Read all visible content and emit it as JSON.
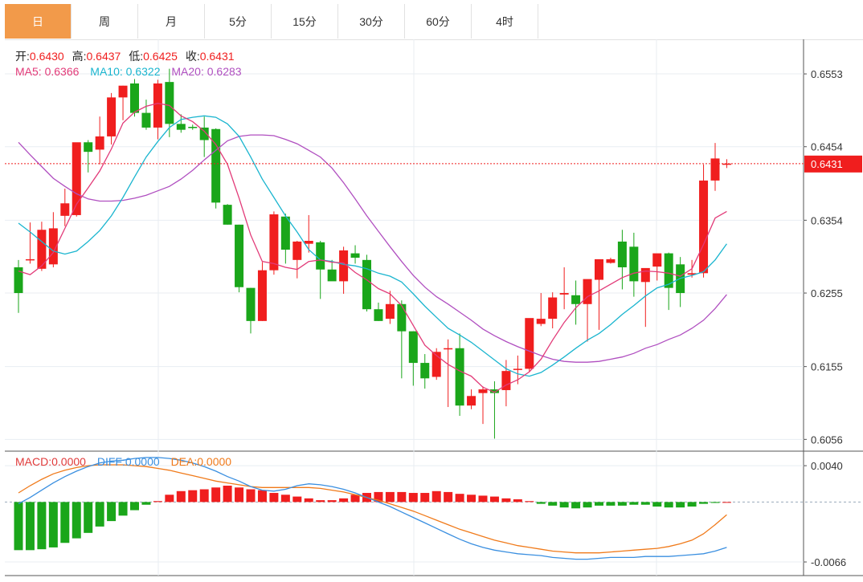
{
  "tabs": [
    "日",
    "周",
    "月",
    "5分",
    "15分",
    "30分",
    "60分",
    "4时"
  ],
  "active_tab": 0,
  "ohlc_info": [
    {
      "label": "开:",
      "value": "0.6430"
    },
    {
      "label": "高:",
      "value": "0.6437"
    },
    {
      "label": "低:",
      "value": "0.6425"
    },
    {
      "label": "收:",
      "value": "0.6431"
    }
  ],
  "ma_info": [
    {
      "label": "MA5:",
      "value": "0.6366",
      "color": "#e23a78"
    },
    {
      "label": "MA10:",
      "value": "0.6322",
      "color": "#1ab5cf"
    },
    {
      "label": "MA20:",
      "value": "0.6283",
      "color": "#b04fc0"
    }
  ],
  "macd_info": [
    {
      "label": "MACD:",
      "value": "0.0000",
      "color": "#e03a3a"
    },
    {
      "label": "DIFF:",
      "value": "0.0000",
      "color": "#3a8fe0"
    },
    {
      "label": "DEA:",
      "value": "0.0000",
      "color": "#f07a1a"
    }
  ],
  "last_price_label": "0.6431",
  "colors": {
    "up": "#f01e1e",
    "down": "#1aa61a",
    "ma5": "#e23a78",
    "ma10": "#1ab5cf",
    "ma20": "#b04fc0",
    "diff": "#3a8fe0",
    "dea": "#f07a1a",
    "price_tag": "#f01e1e"
  },
  "chart_data": {
    "type": "candlestick",
    "y_ticks": [
      "0.6553",
      "0.6454",
      "0.6354",
      "0.6255",
      "0.6155",
      "0.6056"
    ],
    "ylim": [
      0.604,
      0.66
    ],
    "last_price": 0.6431,
    "candles": [
      [
        0.629,
        0.63,
        0.6228,
        0.6255
      ],
      [
        0.6301,
        0.6351,
        0.6295,
        0.6301
      ],
      [
        0.6288,
        0.6352,
        0.6285,
        0.6341
      ],
      [
        0.6294,
        0.6365,
        0.629,
        0.6343
      ],
      [
        0.636,
        0.6397,
        0.6346,
        0.6377
      ],
      [
        0.6361,
        0.6445,
        0.6359,
        0.646
      ],
      [
        0.646,
        0.6463,
        0.6419,
        0.6447
      ],
      [
        0.645,
        0.6495,
        0.643,
        0.6468
      ],
      [
        0.6468,
        0.6527,
        0.6457,
        0.6521
      ],
      [
        0.6521,
        0.6537,
        0.649,
        0.6537
      ],
      [
        0.654,
        0.6546,
        0.6495,
        0.65
      ],
      [
        0.65,
        0.6518,
        0.6477,
        0.648
      ],
      [
        0.648,
        0.6545,
        0.6464,
        0.654
      ],
      [
        0.6542,
        0.656,
        0.6467,
        0.6485
      ],
      [
        0.6485,
        0.6498,
        0.6473,
        0.6477
      ],
      [
        0.6481,
        0.6484,
        0.6477,
        0.648
      ],
      [
        0.648,
        0.6495,
        0.644,
        0.6463
      ],
      [
        0.6478,
        0.6479,
        0.637,
        0.6378
      ],
      [
        0.6375,
        0.6376,
        0.6348,
        0.6348
      ],
      [
        0.6348,
        0.6348,
        0.6256,
        0.6263
      ],
      [
        0.6262,
        0.6262,
        0.62,
        0.6217
      ],
      [
        0.6217,
        0.6297,
        0.6217,
        0.6286
      ],
      [
        0.6286,
        0.6366,
        0.628,
        0.6362
      ],
      [
        0.6359,
        0.6363,
        0.6295,
        0.6314
      ],
      [
        0.63,
        0.6326,
        0.6275,
        0.6325
      ],
      [
        0.6322,
        0.6361,
        0.631,
        0.6326
      ],
      [
        0.6324,
        0.6326,
        0.6247,
        0.6287
      ],
      [
        0.6287,
        0.63,
        0.6272,
        0.6271
      ],
      [
        0.6271,
        0.6318,
        0.6254,
        0.6313
      ],
      [
        0.6309,
        0.632,
        0.6295,
        0.6303
      ],
      [
        0.63,
        0.6307,
        0.623,
        0.6233
      ],
      [
        0.6233,
        0.6242,
        0.6217,
        0.6217
      ],
      [
        0.622,
        0.6258,
        0.6213,
        0.624
      ],
      [
        0.624,
        0.6245,
        0.6139,
        0.6203
      ],
      [
        0.6203,
        0.6203,
        0.6129,
        0.616
      ],
      [
        0.616,
        0.6172,
        0.6125,
        0.6139
      ],
      [
        0.6141,
        0.618,
        0.6137,
        0.6175
      ],
      [
        0.618,
        0.6192,
        0.61,
        0.618
      ],
      [
        0.618,
        0.62,
        0.6088,
        0.6102
      ],
      [
        0.6102,
        0.6124,
        0.6097,
        0.6115
      ],
      [
        0.6119,
        0.6128,
        0.6077,
        0.6124
      ],
      [
        0.6124,
        0.6135,
        0.6057,
        0.6119
      ],
      [
        0.6123,
        0.6164,
        0.6101,
        0.6149
      ],
      [
        0.6151,
        0.617,
        0.6131,
        0.6152
      ],
      [
        0.6152,
        0.6218,
        0.6148,
        0.6221
      ],
      [
        0.6213,
        0.6255,
        0.621,
        0.622
      ],
      [
        0.622,
        0.6256,
        0.6207,
        0.6249
      ],
      [
        0.6253,
        0.629,
        0.6233,
        0.6255
      ],
      [
        0.6252,
        0.6272,
        0.6212,
        0.624
      ],
      [
        0.624,
        0.6268,
        0.6189,
        0.6274
      ],
      [
        0.6273,
        0.63,
        0.6205,
        0.6301
      ],
      [
        0.6296,
        0.6303,
        0.6295,
        0.6301
      ],
      [
        0.6325,
        0.6341,
        0.626,
        0.629
      ],
      [
        0.6318,
        0.6337,
        0.625,
        0.6271
      ],
      [
        0.627,
        0.6275,
        0.6209,
        0.6289
      ],
      [
        0.6291,
        0.6307,
        0.6272,
        0.6309
      ],
      [
        0.6309,
        0.631,
        0.6232,
        0.6262
      ],
      [
        0.6294,
        0.6304,
        0.6236,
        0.6255
      ],
      [
        0.628,
        0.63,
        0.6276,
        0.6282
      ],
      [
        0.6282,
        0.643,
        0.6276,
        0.6408
      ],
      [
        0.6408,
        0.6459,
        0.6394,
        0.6438
      ],
      [
        0.643,
        0.6437,
        0.6425,
        0.6431
      ]
    ],
    "ma5": [
      0.6285,
      0.628,
      0.6292,
      0.631,
      0.6343,
      0.6376,
      0.6398,
      0.6421,
      0.6451,
      0.6486,
      0.6501,
      0.6509,
      0.6513,
      0.651,
      0.6496,
      0.6488,
      0.6475,
      0.6457,
      0.643,
      0.6384,
      0.6334,
      0.6298,
      0.6295,
      0.629,
      0.6287,
      0.6298,
      0.63,
      0.6297,
      0.6296,
      0.6283,
      0.6273,
      0.6261,
      0.6254,
      0.6238,
      0.6211,
      0.6184,
      0.617,
      0.6158,
      0.6149,
      0.6142,
      0.6127,
      0.612,
      0.613,
      0.6137,
      0.6148,
      0.6165,
      0.6191,
      0.6215,
      0.6235,
      0.625,
      0.6258,
      0.6267,
      0.6276,
      0.6282,
      0.6285,
      0.6284,
      0.6282,
      0.6278,
      0.6288,
      0.6321,
      0.6357,
      0.6366
    ],
    "ma10": [
      0.635,
      0.6338,
      0.6325,
      0.6312,
      0.6308,
      0.6312,
      0.6325,
      0.634,
      0.636,
      0.6385,
      0.6413,
      0.644,
      0.6461,
      0.648,
      0.6491,
      0.6494,
      0.6496,
      0.6494,
      0.6485,
      0.6468,
      0.644,
      0.641,
      0.6385,
      0.636,
      0.6338,
      0.6314,
      0.63,
      0.6298,
      0.6294,
      0.6292,
      0.6288,
      0.6282,
      0.6278,
      0.627,
      0.6254,
      0.6237,
      0.6222,
      0.6207,
      0.6198,
      0.6188,
      0.6176,
      0.6164,
      0.6152,
      0.6145,
      0.6142,
      0.6147,
      0.6157,
      0.6168,
      0.618,
      0.6191,
      0.62,
      0.6212,
      0.6226,
      0.6238,
      0.6251,
      0.6262,
      0.6267,
      0.6275,
      0.6279,
      0.6284,
      0.63,
      0.6322
    ],
    "ma20": [
      0.646,
      0.6443,
      0.6427,
      0.6411,
      0.64,
      0.639,
      0.6383,
      0.638,
      0.638,
      0.6381,
      0.6384,
      0.6388,
      0.6394,
      0.64,
      0.641,
      0.6422,
      0.6436,
      0.6449,
      0.6462,
      0.6468,
      0.647,
      0.647,
      0.6469,
      0.6464,
      0.6458,
      0.6449,
      0.644,
      0.6425,
      0.6405,
      0.6383,
      0.636,
      0.6339,
      0.6318,
      0.6298,
      0.6279,
      0.6263,
      0.625,
      0.624,
      0.6229,
      0.6218,
      0.6206,
      0.6197,
      0.6189,
      0.6182,
      0.6176,
      0.617,
      0.6165,
      0.6162,
      0.6161,
      0.6161,
      0.6162,
      0.6165,
      0.6168,
      0.6173,
      0.618,
      0.6185,
      0.6192,
      0.6198,
      0.6207,
      0.6218,
      0.6234,
      0.6253
    ],
    "macd": {
      "y_ticks": [
        "0.0040",
        "-0.0066"
      ],
      "ylim": [
        -0.0081,
        0.0056
      ],
      "diff": [
        -0.0002,
        0.0005,
        0.0013,
        0.0021,
        0.0028,
        0.0034,
        0.0039,
        0.0043,
        0.0045,
        0.0046,
        0.0048,
        0.0049,
        0.0049,
        0.0048,
        0.0046,
        0.0043,
        0.0039,
        0.0034,
        0.0028,
        0.0023,
        0.0017,
        0.0013,
        0.0012,
        0.0014,
        0.0018,
        0.002,
        0.0019,
        0.0017,
        0.0014,
        0.001,
        0.0005,
        0.0,
        -0.0005,
        -0.0011,
        -0.0017,
        -0.0023,
        -0.0029,
        -0.0035,
        -0.0041,
        -0.0046,
        -0.005,
        -0.0053,
        -0.0055,
        -0.0057,
        -0.0058,
        -0.0059,
        -0.0061,
        -0.0062,
        -0.0063,
        -0.0063,
        -0.0062,
        -0.0061,
        -0.0061,
        -0.0061,
        -0.006,
        -0.006,
        -0.006,
        -0.0059,
        -0.0058,
        -0.0057,
        -0.0054,
        -0.005
      ],
      "dea": [
        0.001,
        0.0018,
        0.0025,
        0.0031,
        0.0035,
        0.0038,
        0.004,
        0.0041,
        0.0041,
        0.0041,
        0.004,
        0.0039,
        0.0037,
        0.0035,
        0.0032,
        0.0029,
        0.0026,
        0.0023,
        0.0021,
        0.0019,
        0.0017,
        0.0016,
        0.0016,
        0.0016,
        0.0016,
        0.0016,
        0.0015,
        0.0013,
        0.0011,
        0.0008,
        0.0005,
        0.0002,
        -0.0002,
        -0.0006,
        -0.001,
        -0.0015,
        -0.002,
        -0.0025,
        -0.003,
        -0.0034,
        -0.0038,
        -0.0042,
        -0.0045,
        -0.0048,
        -0.005,
        -0.0052,
        -0.0054,
        -0.0055,
        -0.0056,
        -0.0056,
        -0.0056,
        -0.0055,
        -0.0054,
        -0.0053,
        -0.0052,
        -0.0051,
        -0.0049,
        -0.0046,
        -0.0042,
        -0.0035,
        -0.0025,
        -0.0014
      ],
      "hist": [
        -0.0053,
        -0.0053,
        -0.0052,
        -0.005,
        -0.0045,
        -0.004,
        -0.0034,
        -0.0027,
        -0.0021,
        -0.0015,
        -0.0009,
        -0.0003,
        0.0001,
        0.0008,
        0.0012,
        0.0013,
        0.0014,
        0.0016,
        0.0018,
        0.0016,
        0.0014,
        0.0013,
        0.001,
        0.0008,
        0.0006,
        0.0004,
        0.0002,
        0.0002,
        0.0004,
        0.0008,
        0.001,
        0.0011,
        0.0011,
        0.0011,
        0.001,
        0.001,
        0.0012,
        0.0011,
        0.0009,
        0.0008,
        0.0007,
        0.0006,
        0.0004,
        0.0003,
        0.0001,
        -0.0002,
        -0.0004,
        -0.0006,
        -0.0007,
        -0.0006,
        -0.0004,
        -0.0004,
        -0.0004,
        -0.0003,
        -0.0003,
        -0.0005,
        -0.0006,
        -0.0006,
        -0.0005,
        -0.0002,
        -0.0001,
        0.0
      ]
    }
  }
}
